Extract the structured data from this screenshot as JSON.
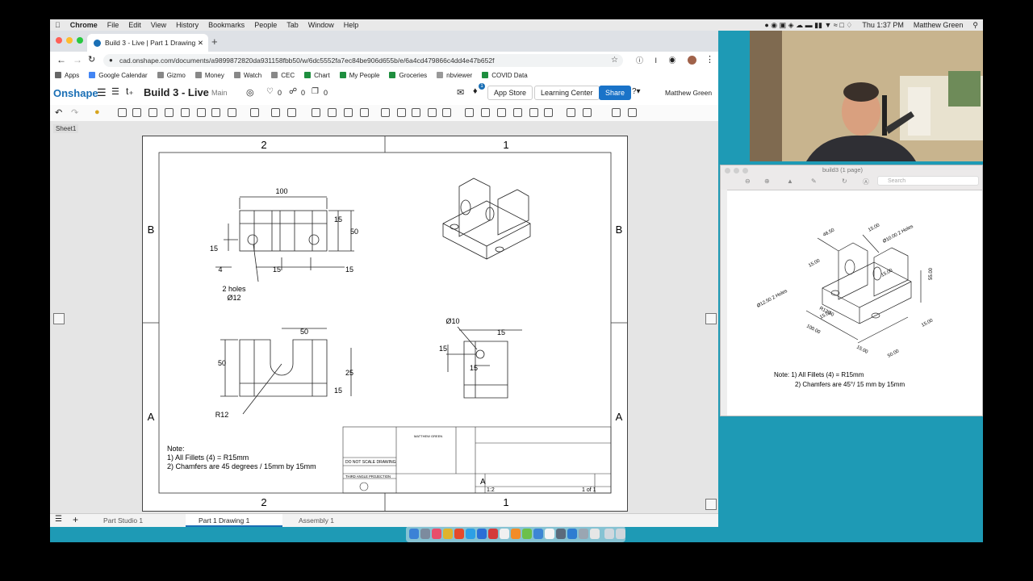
{
  "menubar": {
    "app": "Chrome",
    "items": [
      "File",
      "Edit",
      "View",
      "History",
      "Bookmarks",
      "People",
      "Tab",
      "Window",
      "Help"
    ],
    "clock": "Thu 1:37 PM",
    "user": "Matthew Green"
  },
  "browser": {
    "tab_title": "Build 3 - Live | Part 1 Drawing 1",
    "url": "cad.onshape.com/documents/a9899872820da931158fbb50/w/6dc5552fa7ec84be906d655b/e/6a4cd479866c4dd4e47b652f",
    "bookmarks": [
      "Apps",
      "Google Calendar",
      "Gizmo",
      "Money",
      "Watch",
      "CEC",
      "Chart",
      "My People",
      "Groceries",
      "nbviewer",
      "COVID Data"
    ]
  },
  "onshape": {
    "logo": "Onshape",
    "doc_title": "Build 3 - Live",
    "branch": "Main",
    "likes": "0",
    "links": "0",
    "copies": "0",
    "notif_count": "1",
    "app_store": "App Store",
    "learning_center": "Learning Center",
    "share": "Share",
    "user": "Matthew Green",
    "sheet": "Sheet1",
    "tabs": [
      "Part Studio 1",
      "Part 1 Drawing 1",
      "Assembly 1"
    ]
  },
  "drawing": {
    "zones_top": [
      "2",
      "1"
    ],
    "zones_bottom": [
      "2",
      "1"
    ],
    "zones_side": [
      "B",
      "A"
    ],
    "dims": {
      "d100": "100",
      "d15a": "15",
      "d50a": "50",
      "d15b": "15",
      "d4": "4",
      "d15c": "15",
      "d15d": "15",
      "holes": "2 holes",
      "dia12": "Ø12",
      "d50b": "50",
      "d50c": "50",
      "d25": "25",
      "d15e": "15",
      "r12": "R12",
      "dia10": "Ø10",
      "d15f": "15",
      "d15g": "15",
      "d15h": "15"
    },
    "note_title": "Note:",
    "note1": "1) All Fillets (4) = R15mm",
    "note2": "2) Chamfers are 45 degrees / 15mm by 15mm",
    "titleblock": {
      "do_not_scale": "DO NOT SCALE DRAWING",
      "third_angle": "THIRD ANGLE PROJECTION",
      "size": "A",
      "scale": "1:2",
      "sheet": "1 of 1",
      "drawn_by": "MATTHEW GREEN"
    }
  },
  "preview": {
    "title": "build3 (1 page)",
    "search": "Search",
    "dims": {
      "a": "46.50",
      "b": "15.00",
      "c": "Ø10.00 2 Holes",
      "d": "15.00",
      "e": "15.00",
      "f": "55.00",
      "g": "Ø12.50 2 Holes",
      "h": "R12.50",
      "i": "15.00",
      "j": "100.00",
      "k": "15.00",
      "l": "15.00",
      "m": "50.00"
    },
    "note1": "Note: 1) All Fillets (4) = R15mm",
    "note2": "2) Chamfers are 45°/ 15 mm by 15mm"
  },
  "colors": {
    "desktop": "#1e9ab5",
    "share": "#1a73c8",
    "onshape_blue": "#1a6fb5"
  }
}
